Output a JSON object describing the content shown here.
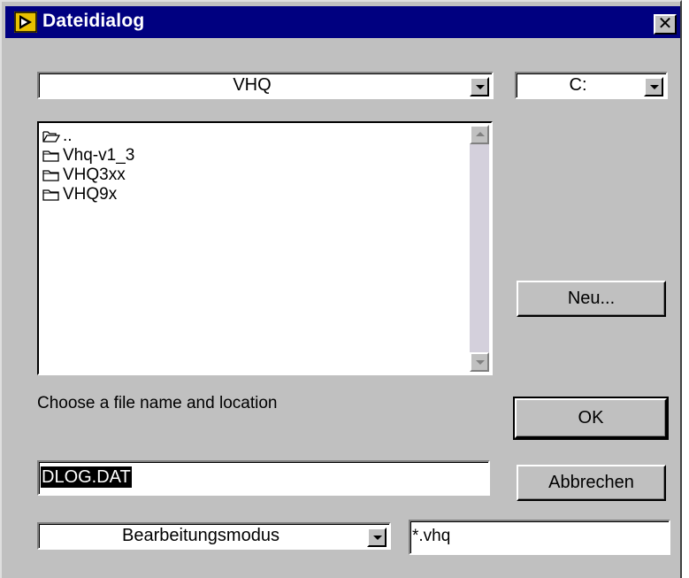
{
  "window": {
    "title": "Dateidialog",
    "close_glyph": "✕"
  },
  "path_dropdown": {
    "value": "VHQ"
  },
  "drive_dropdown": {
    "value": "C:"
  },
  "file_list": {
    "items": [
      {
        "label": "..",
        "icon": "open-folder-icon"
      },
      {
        "label": "Vhq-v1_3",
        "icon": "folder-icon"
      },
      {
        "label": "VHQ3xx",
        "icon": "folder-icon"
      },
      {
        "label": "VHQ9x",
        "icon": "folder-icon"
      }
    ]
  },
  "buttons": {
    "new_label": "Neu...",
    "ok_label": "OK",
    "cancel_label": "Abbrechen"
  },
  "prompt_text": "Choose a file name and location",
  "filename_field": {
    "value": "DLOG.DAT"
  },
  "mode_dropdown": {
    "value": "Bearbeitungsmodus"
  },
  "filter_field": {
    "value": "*.vhq"
  },
  "colors": {
    "titlebar": "#000080",
    "face": "#c0c0c0",
    "scroll_track": "#d4d0dc"
  }
}
